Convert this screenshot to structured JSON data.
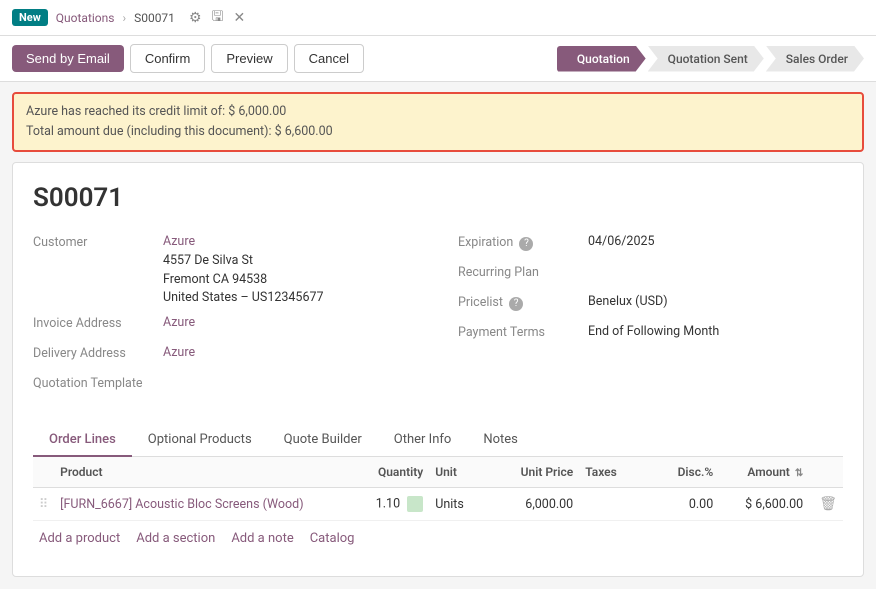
{
  "breadcrumb": {
    "new_badge": "New",
    "parent_label": "Quotations",
    "current_label": "S00071",
    "icons": {
      "settings": "⚙",
      "save": "🖫",
      "discard": "✕"
    }
  },
  "toolbar": {
    "send_by_email": "Send by Email",
    "confirm": "Confirm",
    "preview": "Preview",
    "cancel": "Cancel"
  },
  "status_pipeline": {
    "steps": [
      {
        "label": "Quotation",
        "active": true
      },
      {
        "label": "Quotation Sent",
        "active": false
      },
      {
        "label": "Sales Order",
        "active": false
      }
    ]
  },
  "warning": {
    "line1": "Azure has reached its credit limit of: $ 6,000.00",
    "line2": "Total amount due (including this document): $ 6,600.00"
  },
  "document": {
    "number": "S00071"
  },
  "form": {
    "left": {
      "customer_label": "Customer",
      "customer_name": "Azure",
      "customer_address1": "4557 De Silva St",
      "customer_address2": "Fremont CA 94538",
      "customer_address3": "United States – US12345677",
      "invoice_address_label": "Invoice Address",
      "invoice_address_value": "Azure",
      "delivery_address_label": "Delivery Address",
      "delivery_address_value": "Azure",
      "quotation_template_label": "Quotation Template",
      "quotation_template_value": ""
    },
    "right": {
      "expiration_label": "Expiration",
      "expiration_value": "04/06/2025",
      "recurring_plan_label": "Recurring Plan",
      "recurring_plan_value": "",
      "pricelist_label": "Pricelist",
      "pricelist_value": "Benelux (USD)",
      "payment_terms_label": "Payment Terms",
      "payment_terms_value": "End of Following Month"
    }
  },
  "tabs": [
    {
      "label": "Order Lines",
      "active": true
    },
    {
      "label": "Optional Products",
      "active": false
    },
    {
      "label": "Quote Builder",
      "active": false
    },
    {
      "label": "Other Info",
      "active": false
    },
    {
      "label": "Notes",
      "active": false
    }
  ],
  "order_lines": {
    "columns": {
      "product": "Product",
      "quantity": "Quantity",
      "unit": "Unit",
      "unit_price": "Unit Price",
      "taxes": "Taxes",
      "disc": "Disc.%",
      "amount": "Amount"
    },
    "rows": [
      {
        "product_code": "[FURN_6667]",
        "product_name": "Acoustic Bloc Screens (Wood)",
        "quantity": "1.10",
        "unit": "Units",
        "unit_price": "6,000.00",
        "taxes": "",
        "disc": "0.00",
        "amount": "$ 6,600.00"
      }
    ],
    "add_links": [
      {
        "label": "Add a product"
      },
      {
        "label": "Add a section"
      },
      {
        "label": "Add a note"
      },
      {
        "label": "Catalog"
      }
    ]
  }
}
